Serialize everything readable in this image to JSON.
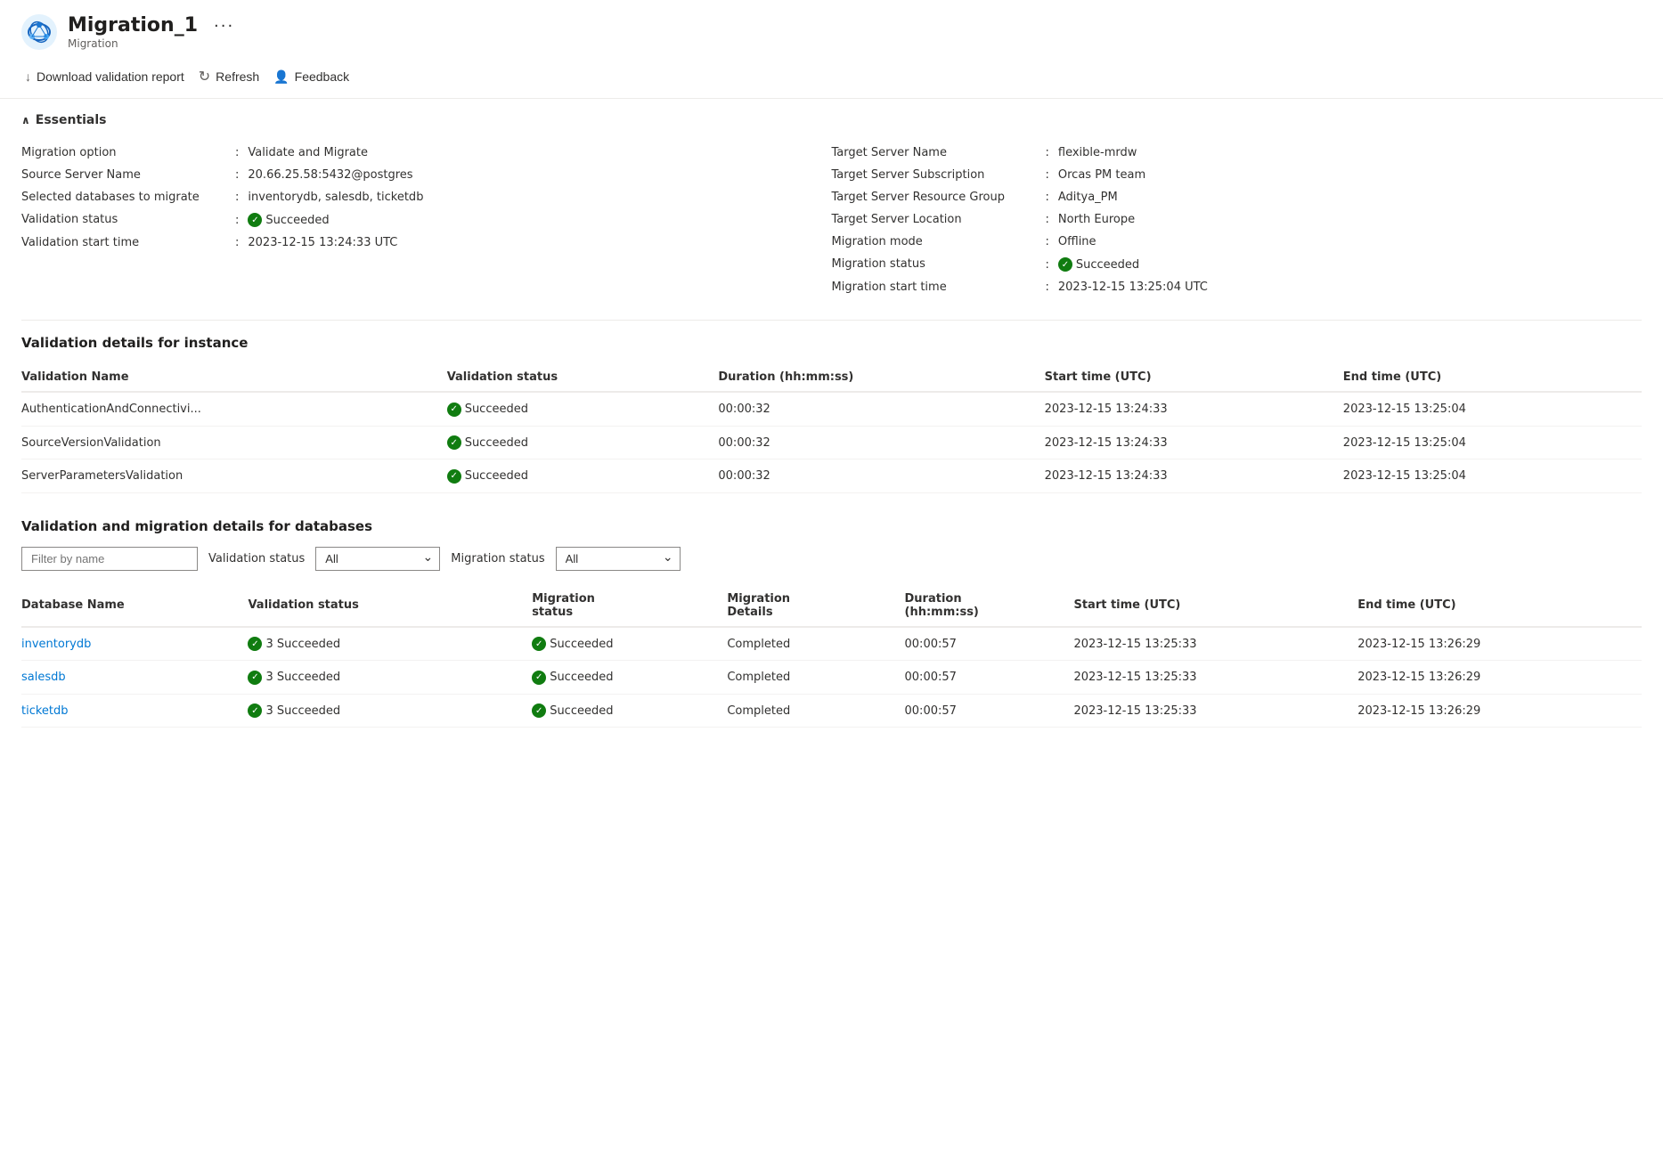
{
  "header": {
    "title": "Migration_1",
    "subtitle": "Migration",
    "more_btn": "···"
  },
  "toolbar": {
    "download_label": "Download validation report",
    "refresh_label": "Refresh",
    "feedback_label": "Feedback"
  },
  "essentials": {
    "section_label": "Essentials",
    "left": [
      {
        "label": "Migration option",
        "value": "Validate and Migrate"
      },
      {
        "label": "Source Server Name",
        "value": "20.66.25.58:5432@postgres"
      },
      {
        "label": "Selected databases to migrate",
        "value": "inventorydb, salesdb, ticketdb"
      },
      {
        "label": "Validation status",
        "value": "Succeeded",
        "is_status": true
      },
      {
        "label": "Validation start time",
        "value": "2023-12-15 13:24:33 UTC"
      }
    ],
    "right": [
      {
        "label": "Target Server Name",
        "value": "flexible-mrdw"
      },
      {
        "label": "Target Server Subscription",
        "value": "Orcas PM team"
      },
      {
        "label": "Target Server Resource Group",
        "value": "Aditya_PM"
      },
      {
        "label": "Target Server Location",
        "value": "North Europe"
      },
      {
        "label": "Migration mode",
        "value": "Offline"
      },
      {
        "label": "Migration status",
        "value": "Succeeded",
        "is_status": true
      },
      {
        "label": "Migration start time",
        "value": "2023-12-15 13:25:04 UTC"
      }
    ]
  },
  "validation_instance": {
    "section_label": "Validation details for instance",
    "columns": [
      "Validation Name",
      "Validation status",
      "Duration (hh:mm:ss)",
      "Start time (UTC)",
      "End time (UTC)"
    ],
    "rows": [
      {
        "name": "AuthenticationAndConnectivi...",
        "status": "Succeeded",
        "duration": "00:00:32",
        "start": "2023-12-15 13:24:33",
        "end": "2023-12-15 13:25:04"
      },
      {
        "name": "SourceVersionValidation",
        "status": "Succeeded",
        "duration": "00:00:32",
        "start": "2023-12-15 13:24:33",
        "end": "2023-12-15 13:25:04"
      },
      {
        "name": "ServerParametersValidation",
        "status": "Succeeded",
        "duration": "00:00:32",
        "start": "2023-12-15 13:24:33",
        "end": "2023-12-15 13:25:04"
      }
    ]
  },
  "validation_databases": {
    "section_label": "Validation and migration details for databases",
    "filter_placeholder": "Filter by name",
    "validation_status_label": "Validation status",
    "migration_status_label": "Migration status",
    "filter_options": [
      "All"
    ],
    "columns": [
      "Database Name",
      "Validation status",
      "Migration status",
      "Migration Details",
      "Duration (hh:mm:ss)",
      "Start time (UTC)",
      "End time (UTC)"
    ],
    "rows": [
      {
        "name": "inventorydb",
        "val_status": "3 Succeeded",
        "mig_status": "Succeeded",
        "mig_details": "Completed",
        "duration": "00:00:57",
        "start": "2023-12-15 13:25:33",
        "end": "2023-12-15 13:26:29"
      },
      {
        "name": "salesdb",
        "val_status": "3 Succeeded",
        "mig_status": "Succeeded",
        "mig_details": "Completed",
        "duration": "00:00:57",
        "start": "2023-12-15 13:25:33",
        "end": "2023-12-15 13:26:29"
      },
      {
        "name": "ticketdb",
        "val_status": "3 Succeeded",
        "mig_status": "Succeeded",
        "mig_details": "Completed",
        "duration": "00:00:57",
        "start": "2023-12-15 13:25:33",
        "end": "2023-12-15 13:26:29"
      }
    ]
  },
  "colors": {
    "succeeded_green": "#107c10",
    "link_blue": "#0078d4"
  }
}
